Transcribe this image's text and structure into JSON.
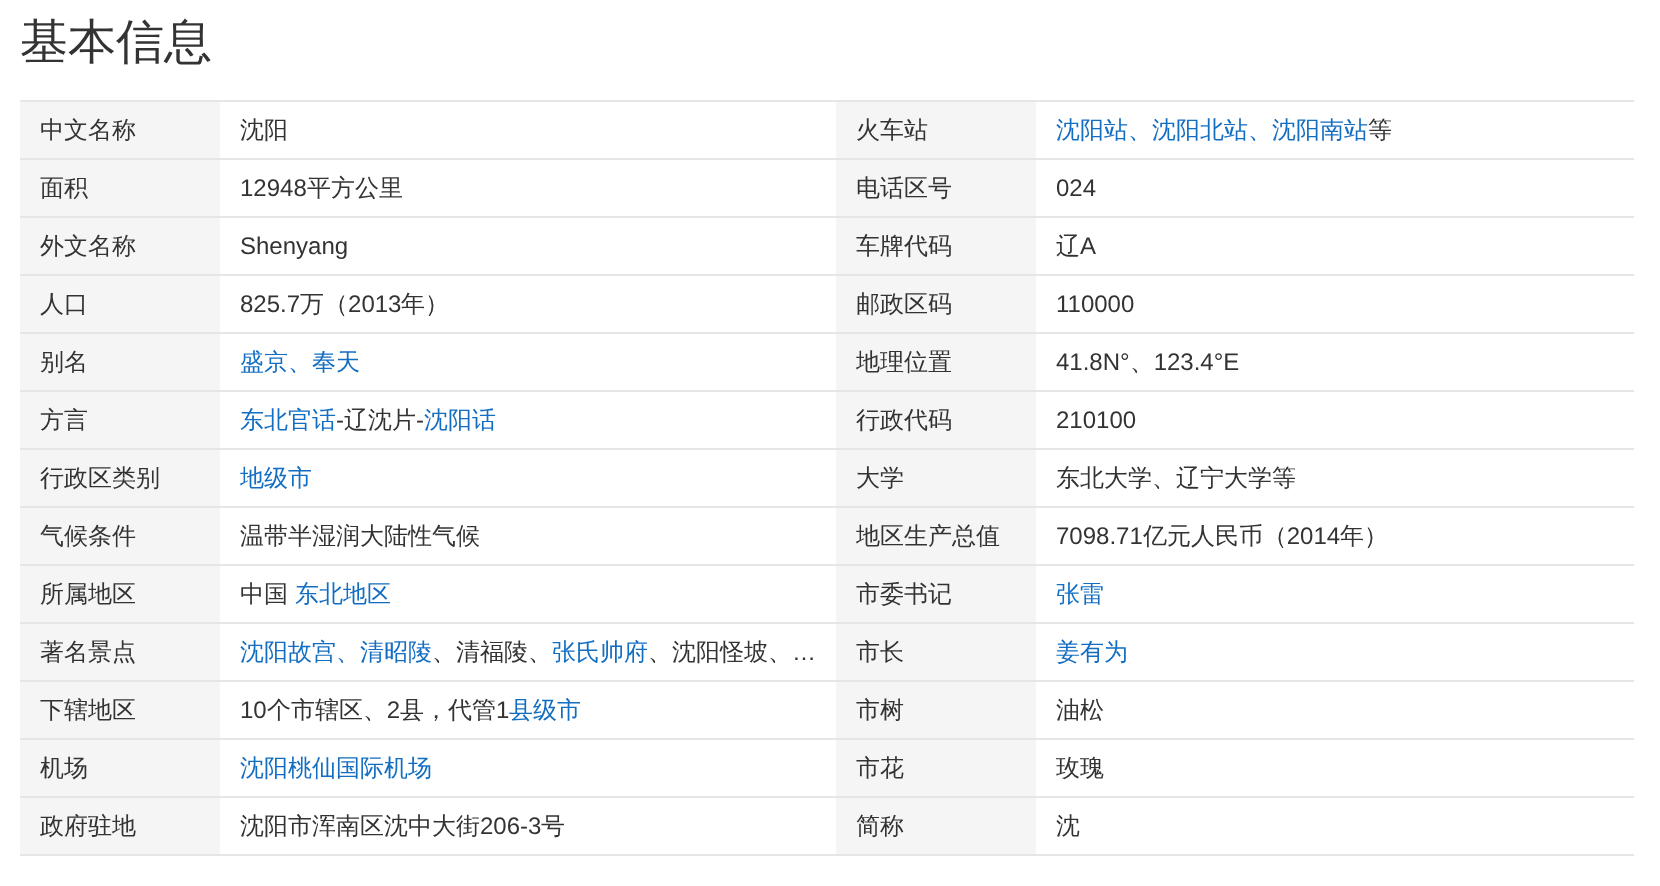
{
  "title": "基本信息",
  "columns": [
    {
      "rows": [
        {
          "label": "中文名称",
          "value": [
            {
              "text": "沈阳",
              "link": false
            }
          ]
        },
        {
          "label": "面积",
          "value": [
            {
              "text": "12948平方公里",
              "link": false
            }
          ]
        },
        {
          "label": "外文名称",
          "value": [
            {
              "text": "Shenyang",
              "link": false
            }
          ]
        },
        {
          "label": "人口",
          "value": [
            {
              "text": "825.7万（2013年）",
              "link": false
            }
          ]
        },
        {
          "label": "别名",
          "value": [
            {
              "text": "盛京、奉天",
              "link": true
            }
          ]
        },
        {
          "label": "方言",
          "value": [
            {
              "text": "东北官话",
              "link": true
            },
            {
              "text": "-辽沈片-",
              "link": false
            },
            {
              "text": "沈阳话",
              "link": true
            }
          ]
        },
        {
          "label": "行政区类别",
          "value": [
            {
              "text": "地级市",
              "link": true
            }
          ]
        },
        {
          "label": "气候条件",
          "value": [
            {
              "text": "温带半湿润大陆性气候",
              "link": false
            }
          ]
        },
        {
          "label": "所属地区",
          "value": [
            {
              "text": "中国 ",
              "link": false
            },
            {
              "text": "东北地区",
              "link": true
            }
          ]
        },
        {
          "label": "著名景点",
          "value": [
            {
              "text": "沈阳故宫、清昭陵",
              "link": true
            },
            {
              "text": "、清福陵、",
              "link": false
            },
            {
              "text": "张氏帅府",
              "link": true
            },
            {
              "text": "、沈阳怪坡、…",
              "link": false
            }
          ]
        },
        {
          "label": "下辖地区",
          "value": [
            {
              "text": "10个市辖区、2县，代管1",
              "link": false
            },
            {
              "text": "县级市",
              "link": true
            }
          ]
        },
        {
          "label": "机场",
          "value": [
            {
              "text": "沈阳桃仙国际机场",
              "link": true
            }
          ]
        },
        {
          "label": "政府驻地",
          "value": [
            {
              "text": "沈阳市浑南区沈中大街206-3号",
              "link": false
            }
          ]
        }
      ]
    },
    {
      "rows": [
        {
          "label": "火车站",
          "value": [
            {
              "text": "沈阳站、沈阳北站、沈阳南站",
              "link": true
            },
            {
              "text": "等",
              "link": false
            }
          ]
        },
        {
          "label": "电话区号",
          "value": [
            {
              "text": "024",
              "link": false
            }
          ]
        },
        {
          "label": "车牌代码",
          "value": [
            {
              "text": "辽A",
              "link": false
            }
          ]
        },
        {
          "label": "邮政区码",
          "value": [
            {
              "text": "110000",
              "link": false
            }
          ]
        },
        {
          "label": "地理位置",
          "value": [
            {
              "text": "41.8N°、123.4°E",
              "link": false
            }
          ]
        },
        {
          "label": "行政代码",
          "value": [
            {
              "text": "210100",
              "link": false
            }
          ]
        },
        {
          "label": "大学",
          "value": [
            {
              "text": "东北大学、辽宁大学等",
              "link": false
            }
          ]
        },
        {
          "label": "地区生产总值",
          "value": [
            {
              "text": "7098.71亿元人民币（2014年）",
              "link": false
            }
          ]
        },
        {
          "label": "市委书记",
          "value": [
            {
              "text": "张雷",
              "link": true
            }
          ]
        },
        {
          "label": "市长",
          "value": [
            {
              "text": "姜有为",
              "link": true
            }
          ]
        },
        {
          "label": "市树",
          "value": [
            {
              "text": "油松",
              "link": false
            }
          ]
        },
        {
          "label": "市花",
          "value": [
            {
              "text": "玫瑰",
              "link": false
            }
          ]
        },
        {
          "label": "简称",
          "value": [
            {
              "text": "沈",
              "link": false
            }
          ]
        }
      ]
    }
  ]
}
